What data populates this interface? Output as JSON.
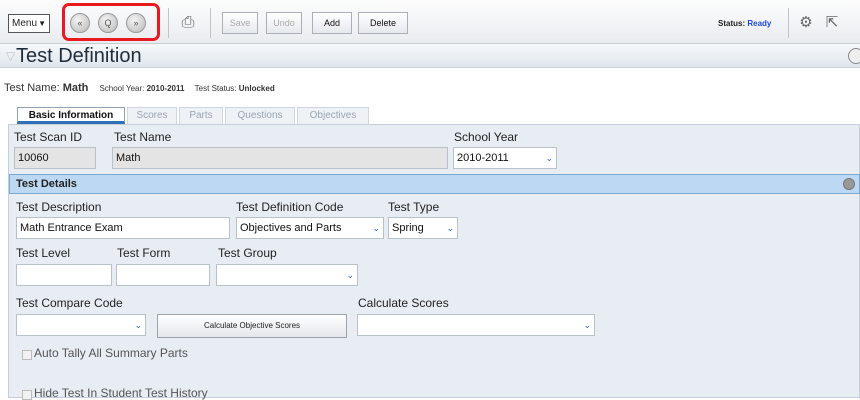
{
  "toolbar": {
    "menu_label": "Menu",
    "nav_first": "«",
    "nav_search": "Q",
    "nav_next": "»",
    "save_label": "Save",
    "undo_label": "Undo",
    "add_label": "Add",
    "delete_label": "Delete",
    "status_label": "Status:",
    "status_value": "Ready",
    "colors": {
      "highlight": "#e8191f",
      "status": "#1a4ad6"
    }
  },
  "page": {
    "title": "Test Definition"
  },
  "info": {
    "test_name_label": "Test Name:",
    "test_name_value": "Math",
    "school_year_label": "School Year:",
    "school_year_value": "2010-2011",
    "test_status_label": "Test Status:",
    "test_status_value": "Unlocked"
  },
  "tabs": [
    {
      "label": "Basic Information"
    },
    {
      "label": "Scores"
    },
    {
      "label": "Parts"
    },
    {
      "label": "Questions"
    },
    {
      "label": "Objectives"
    }
  ],
  "basic": {
    "scan_id_label": "Test Scan ID",
    "scan_id_value": "10060",
    "test_name_label": "Test Name",
    "test_name_value": "Math",
    "school_year_label": "School Year",
    "school_year_value": "2010-2011"
  },
  "details": {
    "header": "Test Details",
    "description_label": "Test Description",
    "description_value": "Math Entrance Exam",
    "def_code_label": "Test Definition Code",
    "def_code_value": "Objectives and Parts",
    "type_label": "Test Type",
    "type_value": "Spring",
    "level_label": "Test Level",
    "form_label": "Test Form",
    "group_label": "Test Group",
    "compare_label": "Test Compare Code",
    "calc_button": "Calculate Objective Scores",
    "calc_scores_label": "Calculate Scores",
    "auto_tally_label": "Auto Tally All Summary Parts",
    "hide_history_label": "Hide Test In Student Test History"
  }
}
